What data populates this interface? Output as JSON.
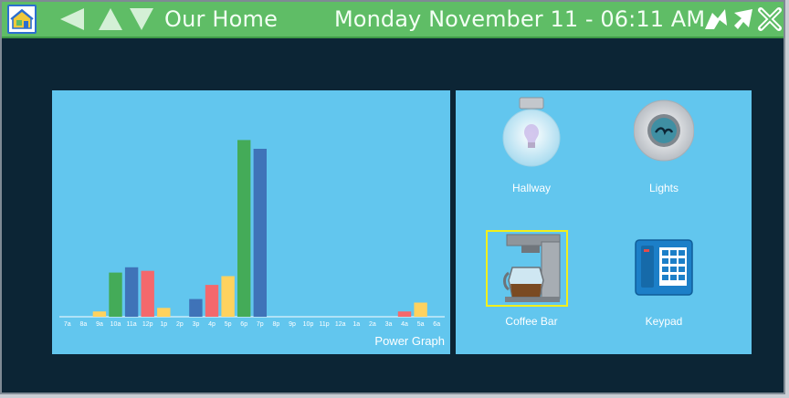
{
  "header": {
    "title": "Our Home",
    "datetime": "Monday November 11 - 06:11 AM",
    "icons": [
      "home-icon",
      "back-arrow-icon",
      "up-arrow-icon",
      "down-arrow-icon",
      "share-icon",
      "reply-icon",
      "close-icon"
    ],
    "colors": {
      "bar": "#5fbd66",
      "text": "#f3fff4",
      "icon": "#ffffff"
    }
  },
  "graph": {
    "title": "Power Graph"
  },
  "chart_data": {
    "type": "bar",
    "title": "Power Graph",
    "categories": [
      "7a",
      "8a",
      "9a",
      "10a",
      "11a",
      "12p",
      "1p",
      "2p",
      "3p",
      "4p",
      "5p",
      "6p",
      "7p",
      "8p",
      "9p",
      "10p",
      "11p",
      "12a",
      "1a",
      "2a",
      "3a",
      "4a",
      "5a",
      "6a"
    ],
    "values": [
      0,
      0,
      3,
      25,
      28,
      26,
      5,
      0,
      10,
      18,
      23,
      100,
      95,
      0,
      0,
      0,
      0,
      0,
      0,
      0,
      0,
      3,
      8,
      0
    ],
    "bar_colors_cycle": [
      "#3f73b8",
      "#f4686c",
      "#ffd25e",
      "#44ab58"
    ],
    "ylim": [
      0,
      110
    ],
    "grid": false
  },
  "devices": [
    {
      "label": "Hallway",
      "icon": "light-bulb-icon"
    },
    {
      "label": "Lights",
      "icon": "lights-dimmer-icon"
    },
    {
      "label": "Coffee Bar",
      "icon": "coffee-maker-icon",
      "selected": true
    },
    {
      "label": "Keypad",
      "icon": "keypad-phone-icon"
    }
  ],
  "colors": {
    "background": "#0c2535",
    "panel": "#62c6ee",
    "selection": "#f3ef1a"
  }
}
